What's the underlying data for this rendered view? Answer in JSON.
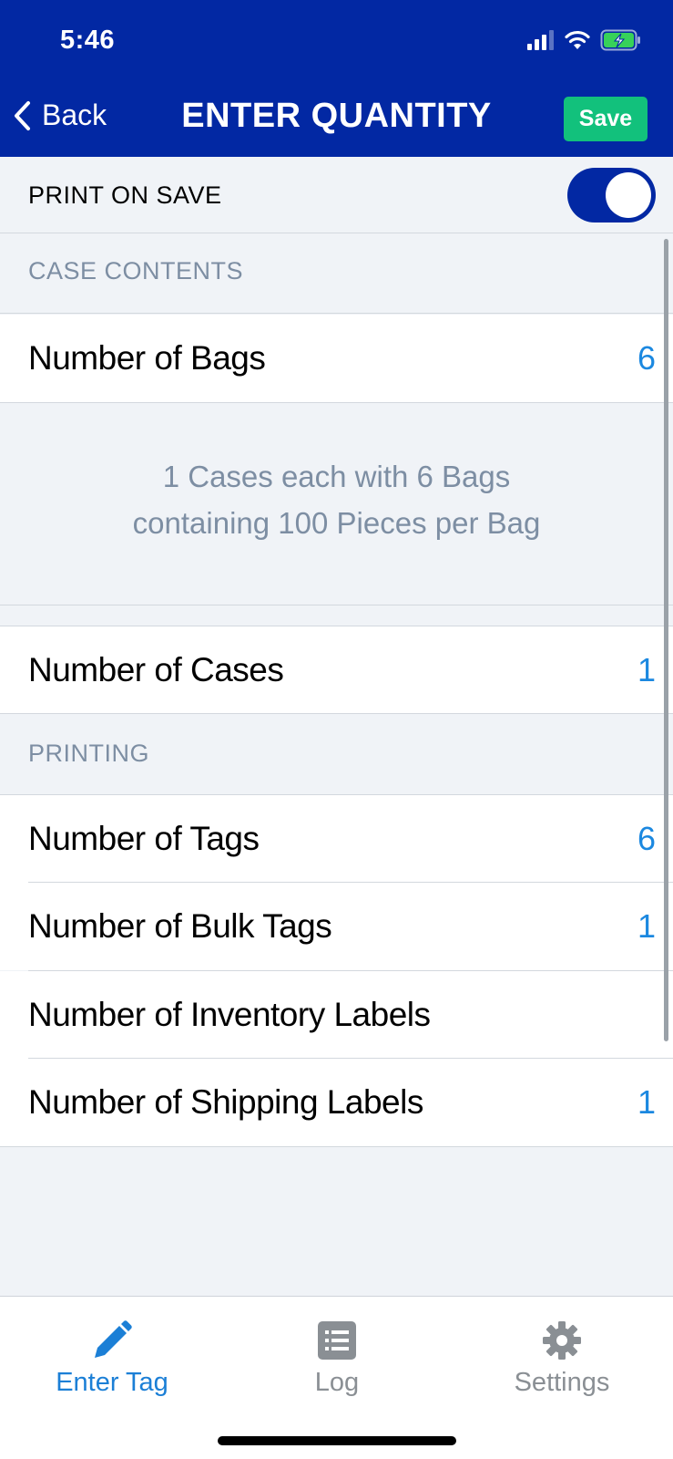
{
  "status_bar": {
    "time": "5:46"
  },
  "nav": {
    "back_label": "Back",
    "title": "ENTER QUANTITY",
    "save_label": "Save"
  },
  "print_on_save": {
    "label": "PRINT ON SAVE",
    "enabled": true
  },
  "case_contents": {
    "header": "CASE CONTENTS",
    "bags": {
      "label": "Number of Bags",
      "value": "6"
    },
    "summary_line1": "1 Cases each with 6 Bags",
    "summary_line2": "containing 100 Pieces per Bag",
    "cases": {
      "label": "Number of Cases",
      "value": "1"
    }
  },
  "printing": {
    "header": "PRINTING",
    "tags": {
      "label": "Number of Tags",
      "value": "6"
    },
    "bulk_tags": {
      "label": "Number of Bulk Tags",
      "value": "1"
    },
    "inventory_labels": {
      "label": "Number of Inventory Labels",
      "value": ""
    },
    "shipping_labels": {
      "label": "Number of Shipping Labels",
      "value": "1"
    }
  },
  "tabbar": {
    "tabs": [
      {
        "label": "Enter Tag",
        "icon": "pencil-icon",
        "active": true
      },
      {
        "label": "Log",
        "icon": "list-icon",
        "active": false
      },
      {
        "label": "Settings",
        "icon": "gear-icon",
        "active": false
      }
    ]
  },
  "colors": {
    "primary": "#0228a3",
    "save_green": "#12c17c",
    "value_blue": "#1b88e0",
    "section_gray": "#7d8ea3"
  }
}
